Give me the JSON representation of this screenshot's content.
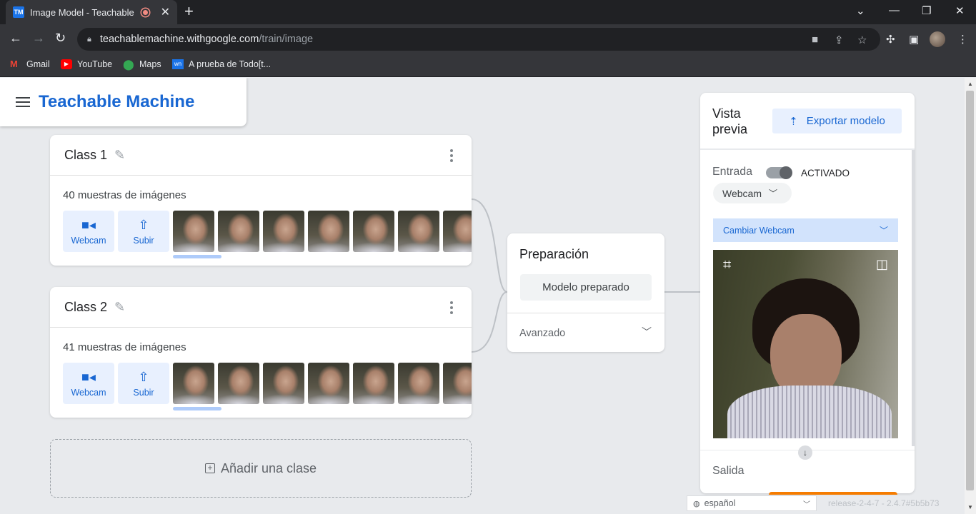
{
  "browser": {
    "tab": {
      "favicon": "TM",
      "title": "Image Model - Teachable Ma",
      "recording_icon": "record-icon",
      "close_icon": "close-icon"
    },
    "new_tab_icon": "plus-icon",
    "window_controls": [
      "chevron-down-icon",
      "minimize-icon",
      "restore-icon",
      "close-icon"
    ],
    "url": {
      "domain": "teachablemachine.withgoogle.com",
      "path": "/train/image"
    },
    "bookmarks": [
      {
        "label": "Gmail",
        "icon": "gmail-icon",
        "color": "#ea4335"
      },
      {
        "label": "YouTube",
        "icon": "youtube-icon",
        "color": "#ff0000"
      },
      {
        "label": "Maps",
        "icon": "maps-icon",
        "color": "#34a853"
      },
      {
        "label": "A prueba de Todo[t...",
        "icon": "wn-icon",
        "color": "#1a73e8"
      }
    ]
  },
  "app": {
    "brand": "Teachable Machine",
    "classes": [
      {
        "name": "Class 1",
        "samples": "40 muestras de imágenes",
        "webcam_label": "Webcam",
        "upload_label": "Subir"
      },
      {
        "name": "Class 2",
        "samples": "41 muestras de imágenes",
        "webcam_label": "Webcam",
        "upload_label": "Subir"
      }
    ],
    "add_class": "Añadir una clase",
    "training": {
      "title": "Preparación",
      "button": "Modelo preparado",
      "advanced": "Avanzado"
    },
    "preview": {
      "title": "Vista previa",
      "export": "Exportar modelo",
      "input_label": "Entrada",
      "toggle_state": "ACTIVADO",
      "input_source": "Webcam",
      "change_webcam": "Cambiar Webcam",
      "output_label": "Salida"
    },
    "footer": {
      "language": "español",
      "release": "release-2-4-7 - 2.4.7#5b5b73"
    },
    "colors": {
      "accent": "#1967d2",
      "accent_light": "#e8f0fe",
      "orange": "#f57c00"
    }
  }
}
